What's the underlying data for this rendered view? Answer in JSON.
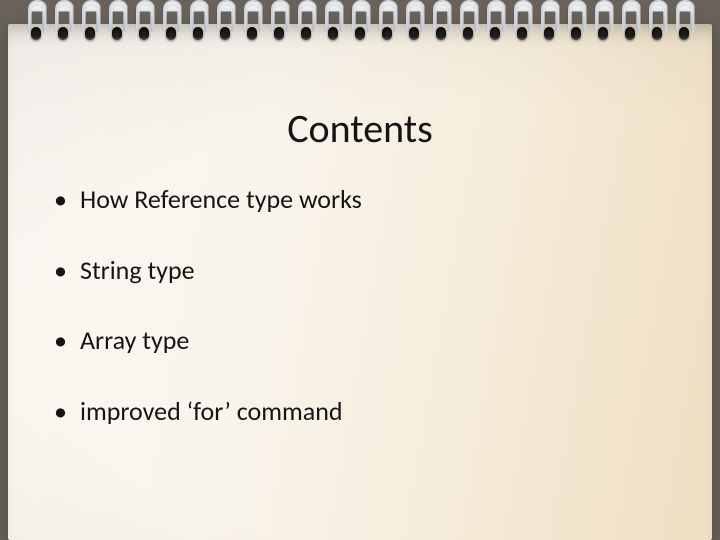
{
  "slide": {
    "title": "Contents",
    "bullets": [
      "How Reference type works",
      "String type",
      "Array type",
      "improved ‘for’ command"
    ],
    "ring_count": 25
  }
}
